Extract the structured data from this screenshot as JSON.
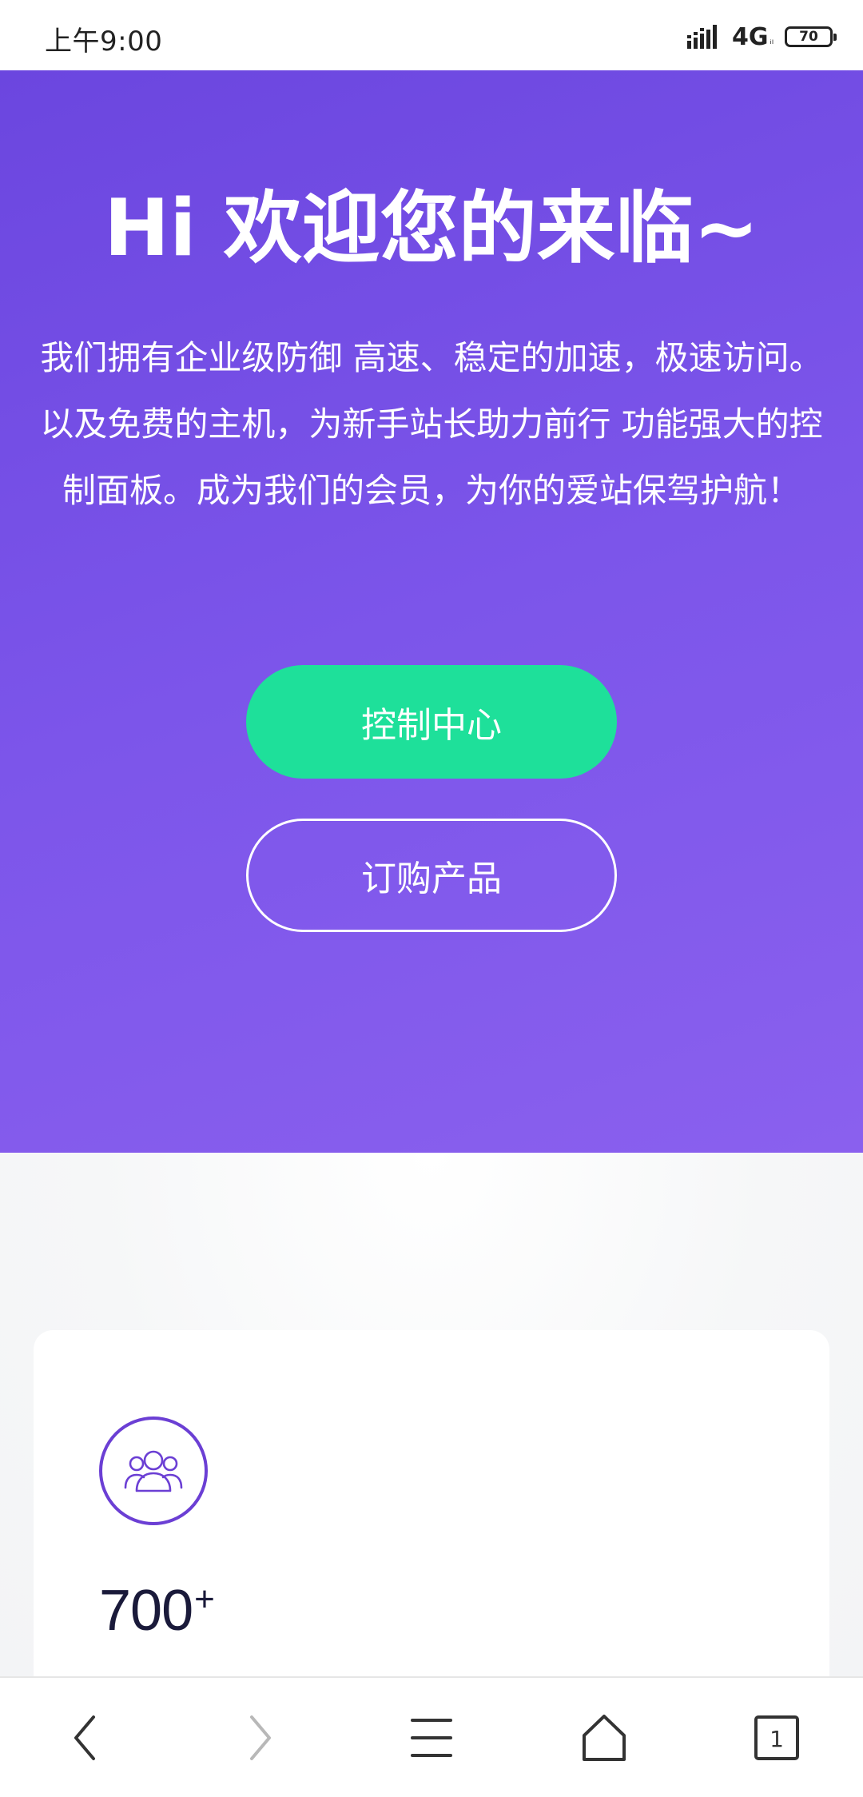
{
  "status_bar": {
    "time": "上午9:00",
    "network": "4G",
    "network_sub": "ᵢₗ",
    "battery_level": "70"
  },
  "hero": {
    "title": "Hi 欢迎您的来临~",
    "description": "我们拥有企业级防御 高速、稳定的加速，极速访问。以及免费的主机，为新手站长助力前行 功能强大的控制面板。成为我们的会员，为你的爱站保驾护航！",
    "primary_button_label": "控制中心",
    "secondary_button_label": "订购产品"
  },
  "stats": {
    "icon": "users-icon",
    "value": "700",
    "suffix": "+"
  },
  "bottom_nav": {
    "tab_count": "1",
    "icons": [
      "back-icon",
      "forward-icon",
      "menu-icon",
      "home-icon",
      "tabs-icon"
    ]
  },
  "colors": {
    "hero_gradient_start": "#6b46df",
    "hero_gradient_end": "#8a60ee",
    "primary_button": "#1ee09a",
    "icon_accent": "#6b3fd4",
    "stat_text": "#1a1a3a"
  }
}
